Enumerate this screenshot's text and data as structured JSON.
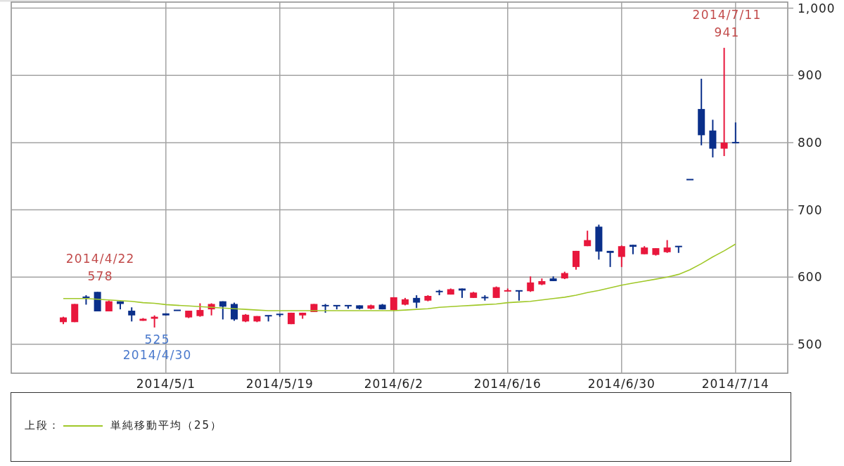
{
  "chart": {
    "chart_data": {
      "type": "candlestick",
      "grid": true,
      "ylim": [
        457,
        1009
      ],
      "yticks": [
        500,
        600,
        700,
        800,
        900,
        {
          "value": 1000,
          "label": "1,000"
        }
      ],
      "categories": [
        null,
        null,
        null,
        null,
        null,
        null,
        null,
        null,
        null,
        "2014/5/1",
        null,
        null,
        null,
        null,
        null,
        null,
        null,
        null,
        null,
        "2014/5/19",
        null,
        null,
        null,
        null,
        null,
        null,
        null,
        null,
        null,
        "2014/6/2",
        null,
        null,
        null,
        null,
        null,
        null,
        null,
        null,
        null,
        "2014/6/16",
        null,
        null,
        null,
        null,
        null,
        null,
        null,
        null,
        null,
        "2014/6/30",
        null,
        null,
        null,
        null,
        null,
        null,
        null,
        null,
        null,
        "2014/7/14"
      ],
      "ohlc": [
        [
          533,
          541,
          530,
          540
        ],
        [
          533,
          560,
          533,
          560
        ],
        [
          571,
          573,
          559,
          569
        ],
        [
          578,
          578,
          549,
          549
        ],
        [
          549,
          565,
          549,
          564
        ],
        [
          564,
          564,
          552,
          560
        ],
        [
          550,
          555,
          534,
          543
        ],
        [
          535,
          539,
          535,
          538
        ],
        [
          538,
          543,
          525,
          541
        ],
        [
          546,
          546,
          543,
          543
        ],
        [
          551,
          551,
          550,
          550
        ],
        [
          540,
          550,
          539,
          550
        ],
        [
          542,
          561,
          541,
          551
        ],
        [
          552,
          561,
          543,
          560
        ],
        [
          564,
          564,
          537,
          556
        ],
        [
          560,
          562,
          535,
          537
        ],
        [
          534,
          545,
          533,
          544
        ],
        [
          534,
          542,
          533,
          542
        ],
        [
          543,
          543,
          534,
          542
        ],
        [
          545,
          545,
          541,
          544
        ],
        [
          530,
          547,
          530,
          547
        ],
        [
          543,
          547,
          538,
          547
        ],
        [
          548,
          560,
          548,
          560
        ],
        [
          558,
          560,
          547,
          557
        ],
        [
          558,
          558,
          552,
          557
        ],
        [
          558,
          558,
          553,
          557
        ],
        [
          558,
          558,
          552,
          553
        ],
        [
          553,
          559,
          552,
          558
        ],
        [
          559,
          560,
          552,
          552
        ],
        [
          551,
          570,
          550,
          570
        ],
        [
          559,
          569,
          558,
          567
        ],
        [
          569,
          573,
          554,
          562
        ],
        [
          565,
          573,
          564,
          572
        ],
        [
          579,
          581,
          573,
          578
        ],
        [
          574,
          583,
          574,
          582
        ],
        [
          583,
          583,
          569,
          580
        ],
        [
          569,
          578,
          569,
          577
        ],
        [
          570,
          573,
          565,
          569
        ],
        [
          569,
          586,
          569,
          585
        ],
        [
          579,
          583,
          579,
          580
        ],
        [
          580,
          580,
          565,
          579
        ],
        [
          579,
          601,
          578,
          592
        ],
        [
          589,
          598,
          588,
          594
        ],
        [
          598,
          601,
          594,
          594
        ],
        [
          598,
          608,
          597,
          606
        ],
        [
          615,
          639,
          611,
          639
        ],
        [
          646,
          669,
          646,
          655
        ],
        [
          675,
          678,
          626,
          638
        ],
        [
          639,
          639,
          615,
          636
        ],
        [
          630,
          647,
          615,
          646
        ],
        [
          648,
          648,
          634,
          645
        ],
        [
          634,
          646,
          634,
          644
        ],
        [
          633,
          643,
          632,
          643
        ],
        [
          637,
          655,
          636,
          644
        ],
        [
          646,
          646,
          636,
          645
        ],
        [
          745,
          745,
          745,
          745
        ],
        [
          850,
          895,
          796,
          811
        ],
        [
          818,
          834,
          778,
          791
        ],
        [
          791,
          941,
          780,
          800
        ],
        [
          800,
          830,
          800,
          800
        ]
      ],
      "series": [
        {
          "type": "line",
          "name": "単純移動平均（25）",
          "color": "#a0c828",
          "values": [
            568,
            568,
            568,
            567,
            566,
            565,
            564,
            562,
            561,
            559,
            558,
            557,
            556,
            555,
            554,
            553,
            552,
            551,
            550,
            550,
            550,
            550,
            550,
            550,
            550,
            550,
            550,
            550,
            550,
            550,
            551,
            552,
            553,
            555,
            556,
            557,
            558,
            559,
            560,
            562,
            563,
            564,
            566,
            568,
            570,
            573,
            577,
            580,
            584,
            588,
            591,
            594,
            597,
            600,
            604,
            611,
            620,
            630,
            639,
            649
          ]
        }
      ],
      "annotations": [
        {
          "y": 578,
          "text": "2014/4/22"
        },
        {
          "y": 578,
          "text": "578"
        },
        {
          "y": 525,
          "text": "525"
        },
        {
          "y": 525,
          "text": "2014/4/30"
        },
        {
          "y": 941,
          "text": "2014/7/11"
        },
        {
          "y": 941,
          "text": "941"
        }
      ]
    }
  },
  "legend": {
    "label": "上段："
  }
}
